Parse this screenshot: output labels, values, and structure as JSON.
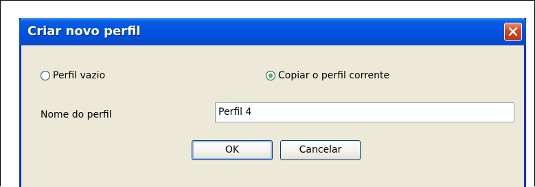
{
  "dialog": {
    "title": "Criar novo perfil",
    "options": {
      "empty_profile": "Perfil vazio",
      "copy_profile": "Copiar o perfil corrente",
      "selected": "copy_profile"
    },
    "name_label": "Nome do perfil",
    "name_value": "Perfil 4",
    "ok_label": "OK",
    "cancel_label": "Cancelar"
  },
  "colors": {
    "titlebar": "#0054e3",
    "dialog_bg": "#ece9d8",
    "close_button": "#d5451f",
    "radio_dot": "#21a121"
  },
  "icons": {
    "close": "close-icon"
  }
}
